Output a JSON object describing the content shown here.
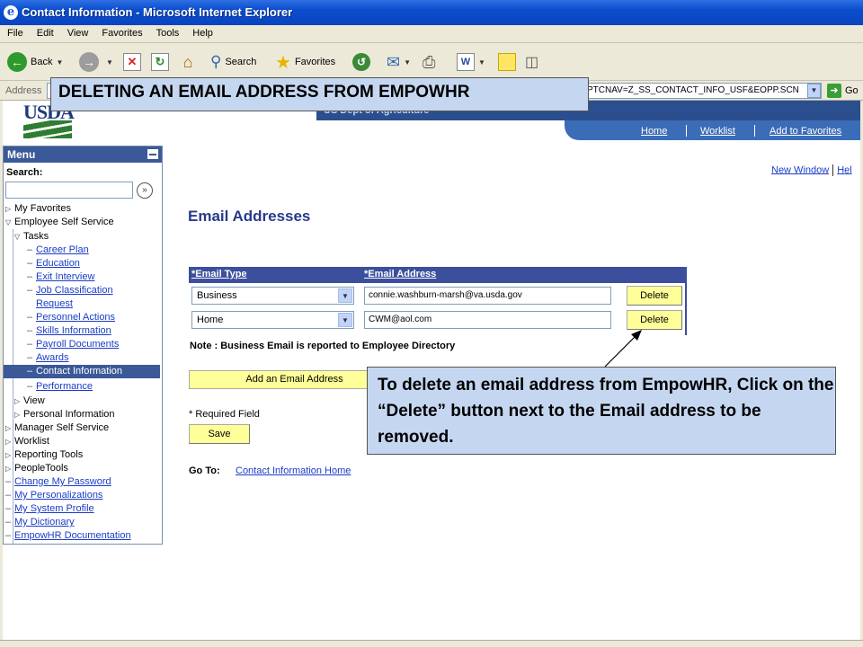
{
  "window": {
    "title": "Contact Information - Microsoft Internet Explorer"
  },
  "menubar": [
    "File",
    "Edit",
    "View",
    "Favorites",
    "Tools",
    "Help"
  ],
  "toolbar": {
    "back_label": "Back",
    "search_label": "Search",
    "favorites_label": "Favorites"
  },
  "address": {
    "label": "Address",
    "url": "PTCNAV=Z_SS_CONTACT_INFO_USF&EOPP.SCN",
    "go_label": "Go"
  },
  "header": {
    "logo_text": "USDA",
    "banner_text": "US Dept of Agriculture",
    "nav": [
      "Home",
      "Worklist",
      "Add to Favorites"
    ],
    "new_window": "New Window",
    "help": "Hel"
  },
  "menu": {
    "title": "Menu",
    "search_label": "Search:",
    "items": [
      {
        "label": "My Favorites",
        "kind": "folder"
      },
      {
        "label": "Employee Self Service",
        "kind": "folder-open"
      },
      {
        "label": "Tasks",
        "kind": "folder-open"
      },
      {
        "label": "Career Plan",
        "kind": "link"
      },
      {
        "label": "Education",
        "kind": "link"
      },
      {
        "label": "Exit Interview",
        "kind": "link"
      },
      {
        "label": "Job Classification",
        "kind": "link"
      },
      {
        "label": "Request",
        "kind": "link"
      },
      {
        "label": "Personnel Actions",
        "kind": "link"
      },
      {
        "label": "Skills Information",
        "kind": "link"
      },
      {
        "label": "Payroll Documents",
        "kind": "link"
      },
      {
        "label": "Awards",
        "kind": "link"
      },
      {
        "label": "Contact Information",
        "kind": "selected"
      },
      {
        "label": "Performance",
        "kind": "link"
      },
      {
        "label": "View",
        "kind": "folder"
      },
      {
        "label": "Personal Information",
        "kind": "folder"
      },
      {
        "label": "Manager Self Service",
        "kind": "folder"
      },
      {
        "label": "Worklist",
        "kind": "folder"
      },
      {
        "label": "Reporting Tools",
        "kind": "folder"
      },
      {
        "label": "PeopleTools",
        "kind": "folder"
      },
      {
        "label": "Change My Password",
        "kind": "link"
      },
      {
        "label": "My Personalizations",
        "kind": "link"
      },
      {
        "label": "My System Profile",
        "kind": "link"
      },
      {
        "label": "My Dictionary",
        "kind": "link"
      },
      {
        "label": "EmpowHR Documentation",
        "kind": "link"
      }
    ]
  },
  "main": {
    "heading": "Email Addresses",
    "columns": [
      "*Email Type",
      "*Email Address"
    ],
    "rows": [
      {
        "type": "Business",
        "address": "connie.washburn-marsh@va.usda.gov",
        "action": "Delete"
      },
      {
        "type": "Home",
        "address": "CWM@aol.com",
        "action": "Delete"
      }
    ],
    "note": "Note : Business Email is reported to Employee Directory",
    "add_button": "Add an Email Address",
    "required": "* Required Field",
    "save_button": "Save",
    "goto_label": "Go To:",
    "goto_link": "Contact Information Home"
  },
  "overlay": {
    "title": "DELETING AN EMAIL ADDRESS FROM EMPOWHR",
    "note": "To delete an email address from EmpowHR, Click on the “Delete” button next to the Email address to be removed."
  },
  "colors": {
    "accent": "#3b4f9c",
    "button": "#ffff99",
    "callout": "#c5d6f0"
  }
}
